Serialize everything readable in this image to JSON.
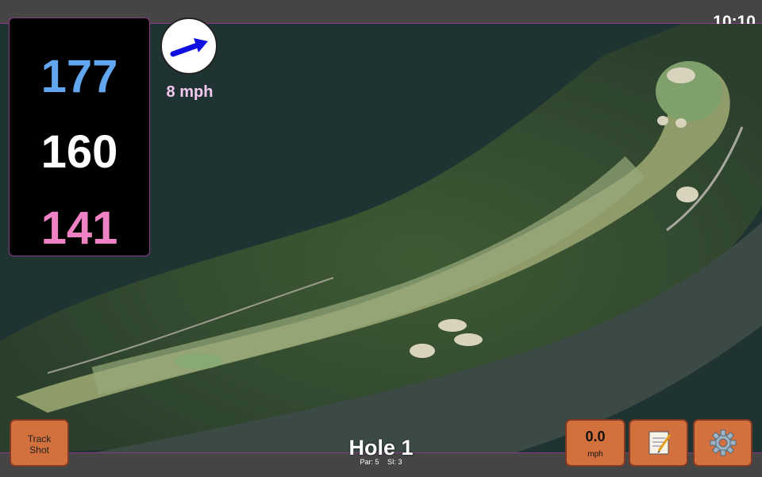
{
  "status": {
    "time": "10:10"
  },
  "distances": {
    "back": "177",
    "middle": "160",
    "front": "141"
  },
  "wind": {
    "speed": "8 mph",
    "icon": "wind-arrow-icon",
    "arrow_color": "#1010e0"
  },
  "buttons": {
    "track_shot_line1": "Track",
    "track_shot_line2": "Shot",
    "speed_value": "0.0",
    "speed_unit": "mph",
    "notes_icon": "notepad-icon",
    "settings_icon": "gear-icon"
  },
  "hole": {
    "title": "Hole 1",
    "par": "Par: 5",
    "si": "SI: 3"
  },
  "colors": {
    "back": "#62a6f0",
    "middle": "#ffffff",
    "front": "#ef82c4",
    "button": "#d2703e",
    "bar": "#454545",
    "accent": "#8a3a86"
  }
}
